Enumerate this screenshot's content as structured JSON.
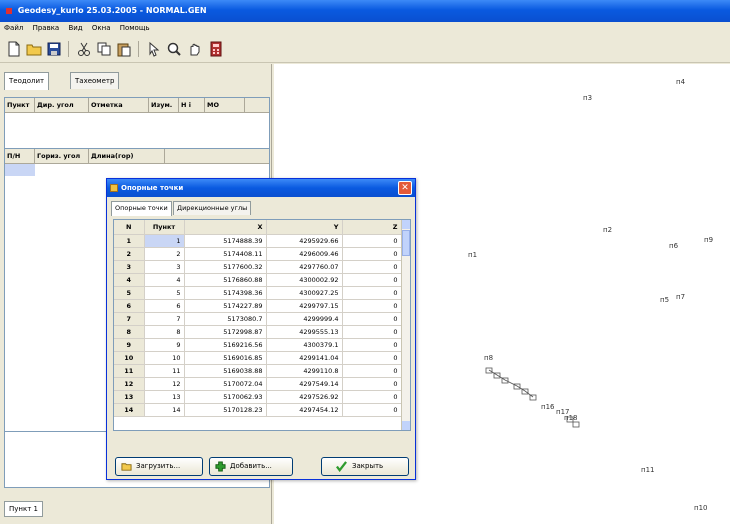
{
  "window": {
    "title": "Geodesy_kurlo 25.03.2005 - NORMAL.GEN"
  },
  "menu": [
    "Файл",
    "Правка",
    "Вид",
    "Окна",
    "Помощь"
  ],
  "left": {
    "tabs": [
      "Теодолит",
      "Тахеометр"
    ],
    "grid1_headers": [
      "Пункт",
      "Дир. угол",
      "Отметка",
      "Изум.",
      "H i",
      "МО"
    ],
    "grid2_headers": [
      "П/Н",
      "Гориз. угол",
      "Длина(гор)"
    ],
    "status_tab": "Пункт 1"
  },
  "dialog": {
    "title": "Опорные точки",
    "close": "✕",
    "tabs": [
      "Опорные точки",
      "Дирекционные углы"
    ],
    "headers": [
      "N",
      "Пункт",
      "X",
      "Y",
      "Z"
    ],
    "rows": [
      [
        "1",
        "1",
        "5174888.39",
        "4295929.66",
        "0"
      ],
      [
        "2",
        "2",
        "5174408.11",
        "4296009.46",
        "0"
      ],
      [
        "3",
        "3",
        "5177600.32",
        "4297760.07",
        "0"
      ],
      [
        "4",
        "4",
        "5176860.88",
        "4300002.92",
        "0"
      ],
      [
        "5",
        "5",
        "5174398.36",
        "4300927.25",
        "0"
      ],
      [
        "6",
        "6",
        "5174227.89",
        "4299797.15",
        "0"
      ],
      [
        "7",
        "7",
        "5173080.7",
        "4299999.4",
        "0"
      ],
      [
        "8",
        "8",
        "5172998.87",
        "4299555.13",
        "0"
      ],
      [
        "9",
        "9",
        "5169216.56",
        "4300379.1",
        "0"
      ],
      [
        "10",
        "10",
        "5169016.85",
        "4299141.04",
        "0"
      ],
      [
        "11",
        "11",
        "5169038.88",
        "4299110.8",
        "0"
      ],
      [
        "12",
        "12",
        "5170072.04",
        "4297549.14",
        "0"
      ],
      [
        "13",
        "13",
        "5170062.93",
        "4297526.92",
        "0"
      ],
      [
        "14",
        "14",
        "5170128.23",
        "4297454.12",
        "0"
      ]
    ],
    "buttons": {
      "load": "Загрузить...",
      "add": "Добавить...",
      "close": "Закрыть"
    }
  },
  "canvas_labels": [
    {
      "id": "p4",
      "text": "п4"
    },
    {
      "id": "p3",
      "text": "п3"
    },
    {
      "id": "p2",
      "text": "п2"
    },
    {
      "id": "p6",
      "text": "п6"
    },
    {
      "id": "p9",
      "text": "п9"
    },
    {
      "id": "p1",
      "text": "п1"
    },
    {
      "id": "p5",
      "text": "п5"
    },
    {
      "id": "p7",
      "text": "п7"
    },
    {
      "id": "p8",
      "text": "п8"
    },
    {
      "id": "p16",
      "text": "п16"
    },
    {
      "id": "p17",
      "text": "п17"
    },
    {
      "id": "p18",
      "text": "п18"
    },
    {
      "id": "p11",
      "text": "п11"
    },
    {
      "id": "p10",
      "text": "п10"
    }
  ],
  "colors": {
    "titlebar": "#0a5ae0",
    "selection": "#c9d6f5",
    "panel": "#ece9d8"
  }
}
